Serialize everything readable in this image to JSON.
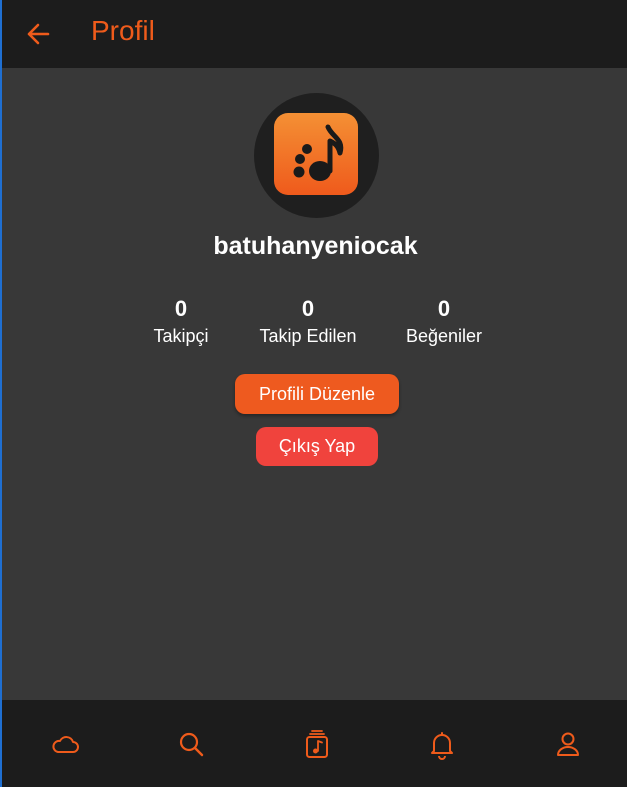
{
  "header": {
    "title": "Profil",
    "back_icon": "arrow-left-icon"
  },
  "profile": {
    "username": "batuhanyeniocak",
    "avatar_icon": "music-note-logo",
    "stats": [
      {
        "value": "0",
        "label": "Takipçi"
      },
      {
        "value": "0",
        "label": "Takip Edilen"
      },
      {
        "value": "0",
        "label": "Beğeniler"
      }
    ]
  },
  "actions": {
    "edit_label": "Profili Düzenle",
    "logout_label": "Çıkış Yap"
  },
  "bottom_nav": [
    "cloud-icon",
    "search-icon",
    "playlist-icon",
    "bell-icon",
    "user-icon"
  ],
  "colors": {
    "accent": "#ef5b1b",
    "logout": "#f0433d",
    "bar_background": "#1c1c1c",
    "page_background": "#383838"
  }
}
